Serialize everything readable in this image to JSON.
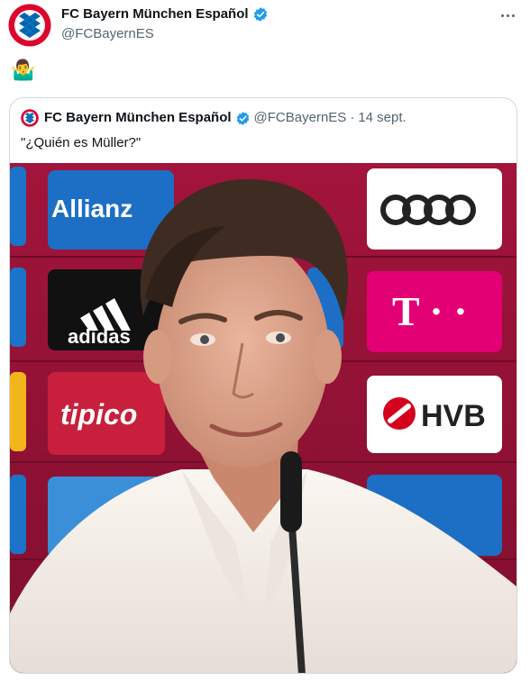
{
  "author": {
    "display_name": "FC Bayern München Español",
    "handle": "@FCBayernES",
    "verified": true,
    "avatar_icon": "fc-bayern-logo"
  },
  "tweet": {
    "text": "🤷‍♂️"
  },
  "quoted_tweet": {
    "display_name": "FC Bayern München Español",
    "handle": "@FCBayernES",
    "separator": "·",
    "date": "14 sept.",
    "text": "\"¿Quién es Müller?\"",
    "media": {
      "kind": "photo",
      "sponsor_boards": [
        "Allianz",
        "adidas",
        "T · ·",
        "tipico",
        "HVB"
      ]
    }
  },
  "colors": {
    "verified_blue": "#1d9bf0",
    "bayern_red": "#dc052d",
    "bayern_blue": "#0066b2",
    "backdrop_red": "#9b1237"
  }
}
